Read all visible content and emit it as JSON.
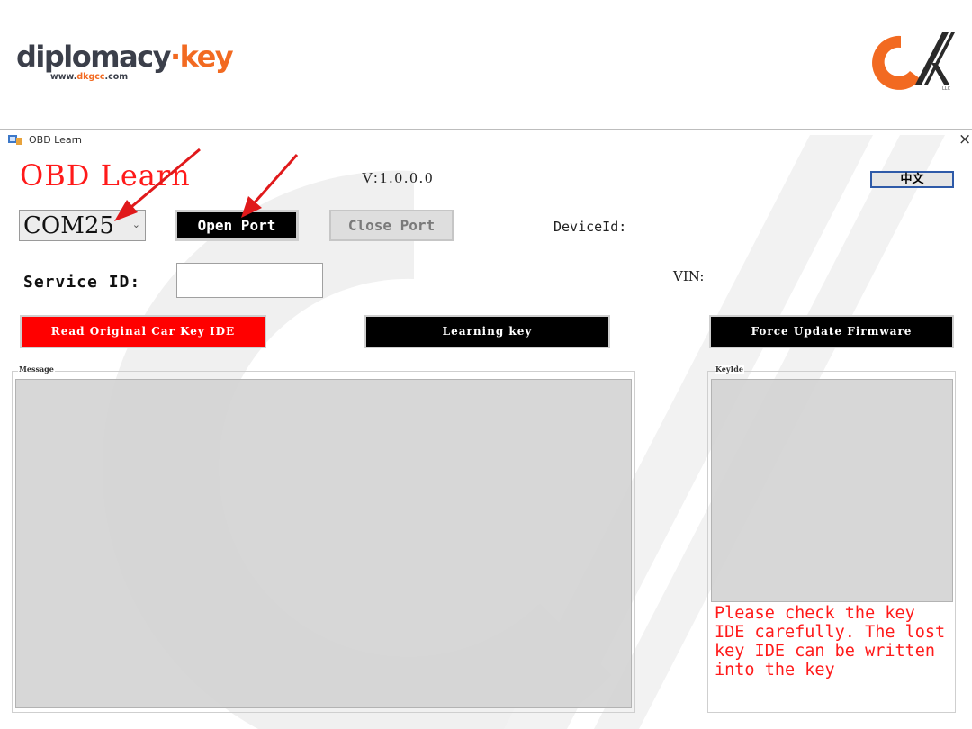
{
  "header": {
    "brand_main_prefix": "diplomacy",
    "brand_main_dot": "·",
    "brand_main_suffix": "key",
    "brand_url_prefix": "www.",
    "brand_url_mid": "dkgcc",
    "brand_url_suffix": ".com",
    "logo_suffix": "LLC",
    "accent_color": "#f26a21"
  },
  "window": {
    "title": "OBD Learn",
    "close_glyph": "×"
  },
  "app": {
    "title": "OBD Learn",
    "version": "V:1.0.0.0",
    "language_button": "中文",
    "port_select": {
      "value": "COM25",
      "chevron": "⌄"
    },
    "open_port_label": "Open Port",
    "close_port_label": "Close Port",
    "device_id_label": "DeviceId:",
    "service_id_label": "Service ID:",
    "service_id_value": "",
    "vin_label": "VIN:",
    "read_key_label": "Read Original Car Key IDE",
    "learning_key_label": "Learning key",
    "force_update_label": "Force Update Firmware",
    "message_legend": "Message",
    "keyide_legend": "KeyIde",
    "key_note": "Please check the key IDE carefully. The lost key IDE can be written into the key",
    "colors": {
      "alert_red": "#ff0000",
      "button_black": "#000000",
      "panel_gray": "#d4d4d4"
    }
  },
  "annotations": {
    "arrow_color": "#e0191b",
    "arrows": [
      "points-to-com-port-select",
      "points-to-open-port-button"
    ]
  }
}
